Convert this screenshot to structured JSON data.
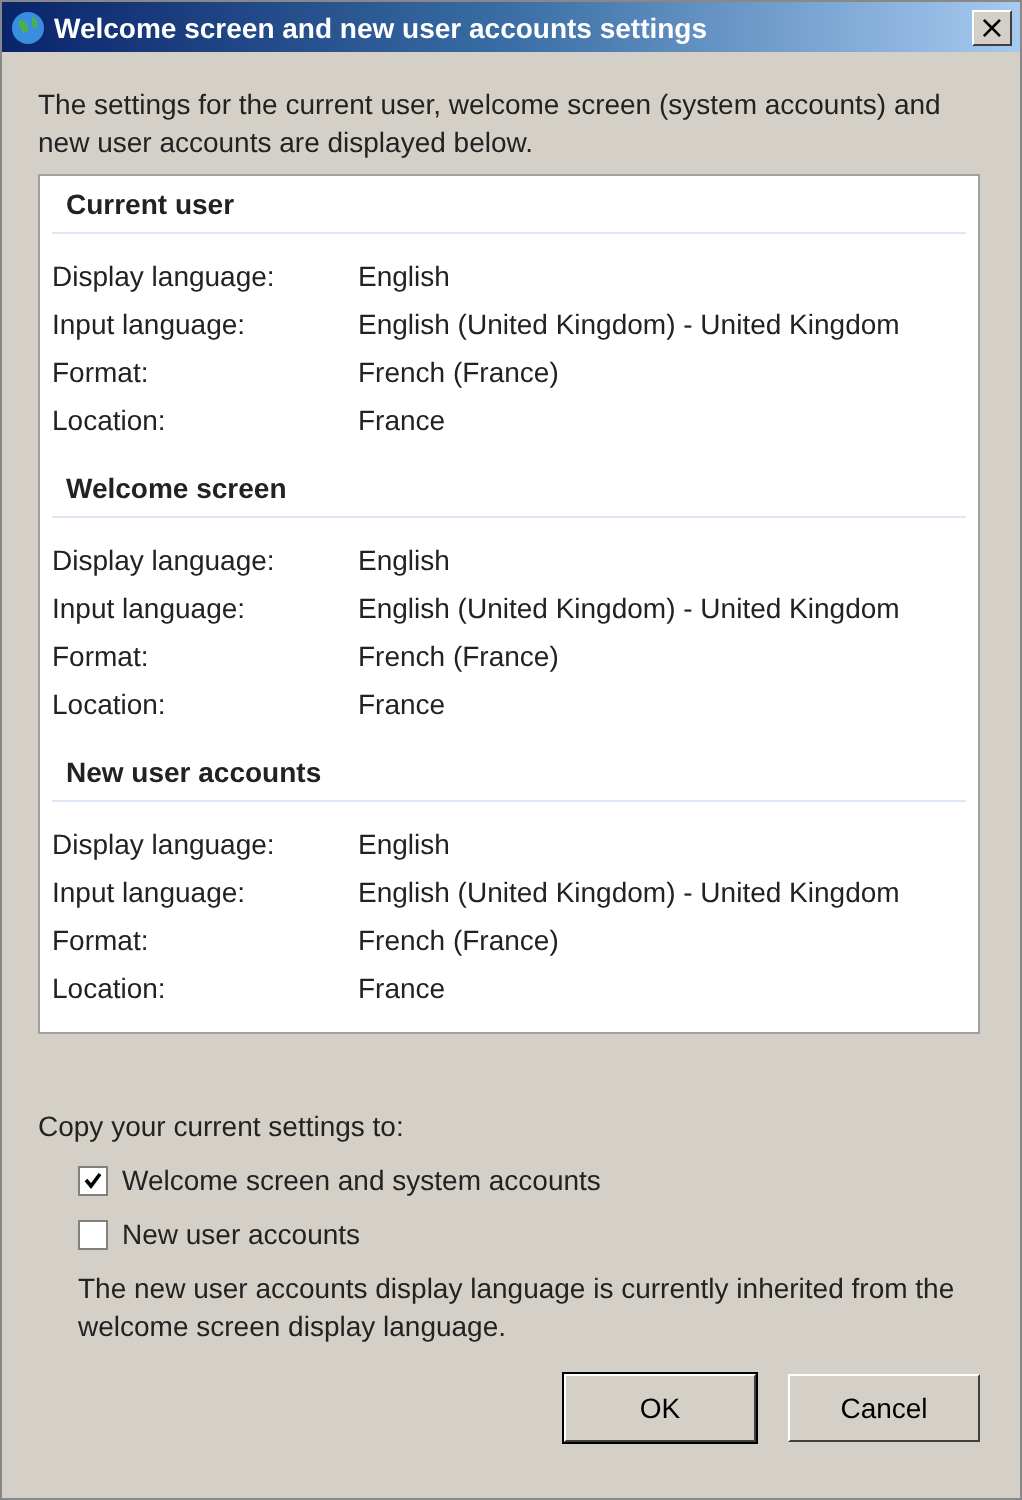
{
  "window": {
    "title": "Welcome screen and new user accounts settings",
    "close": "×"
  },
  "intro": "The settings for the current user, welcome screen (system accounts) and new user accounts are displayed below.",
  "sections": [
    {
      "heading": "Current user",
      "rows": [
        {
          "label": "Display language:",
          "value": "English"
        },
        {
          "label": "Input language:",
          "value": "English (United Kingdom) - United Kingdom"
        },
        {
          "label": "Format:",
          "value": "French (France)"
        },
        {
          "label": "Location:",
          "value": "France"
        }
      ]
    },
    {
      "heading": "Welcome screen",
      "rows": [
        {
          "label": "Display language:",
          "value": "English"
        },
        {
          "label": "Input language:",
          "value": "English (United Kingdom) - United Kingdom"
        },
        {
          "label": "Format:",
          "value": "French (France)"
        },
        {
          "label": "Location:",
          "value": "France"
        }
      ]
    },
    {
      "heading": "New user accounts",
      "rows": [
        {
          "label": "Display language:",
          "value": "English"
        },
        {
          "label": "Input language:",
          "value": "English (United Kingdom) - United Kingdom"
        },
        {
          "label": "Format:",
          "value": "French (France)"
        },
        {
          "label": "Location:",
          "value": "France"
        }
      ]
    }
  ],
  "copy_label": "Copy your current settings to:",
  "checkboxes": [
    {
      "label": "Welcome screen and system accounts",
      "checked": true
    },
    {
      "label": "New user accounts",
      "checked": false
    }
  ],
  "note": "The new user accounts display language is currently inherited from the welcome screen display language.",
  "buttons": [
    {
      "label": "OK",
      "default": true
    },
    {
      "label": "Cancel",
      "default": false
    }
  ]
}
